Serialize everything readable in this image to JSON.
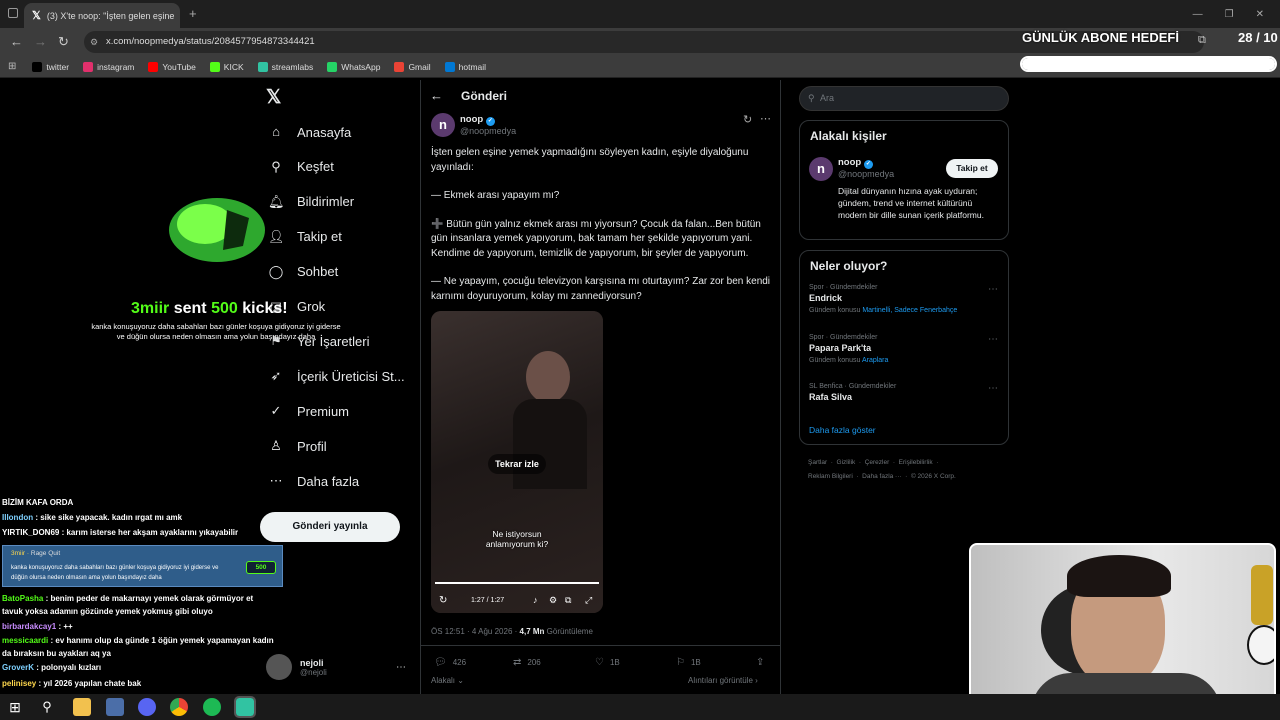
{
  "browser": {
    "tab_title": "(3) X'te noop: \"İşten gelen eşine",
    "url": "x.com/noopmedya/status/2084577954873344421",
    "bookmarks": [
      {
        "label": "twitter",
        "color": "#000000"
      },
      {
        "label": "instagram",
        "color": "#e1306c"
      },
      {
        "label": "YouTube",
        "color": "#ff0000"
      },
      {
        "label": "KICK",
        "color": "#53fc18"
      },
      {
        "label": "streamlabs",
        "color": "#31c3a2"
      },
      {
        "label": "WhatsApp",
        "color": "#25d366"
      },
      {
        "label": "Gmail",
        "color": "#ea4335"
      },
      {
        "label": "hotmail",
        "color": "#0078d4"
      }
    ]
  },
  "goal": {
    "title": "GÜNLÜK ABONE HEDEFİ",
    "count": "28 / 10",
    "fraction": 1.0
  },
  "alert": {
    "name": "3miir",
    "sent": "sent",
    "amount": "500",
    "kicks": "kicks!",
    "message": "kanka konuşuyoruz daha sabahları bazı günler koşuya gidiyoruz iyi giderse ve düğün olursa neden olmasın ama yolun başındayız daha"
  },
  "nav": {
    "items": [
      {
        "label": "Anasayfa",
        "icon": "home-icon",
        "glyph": "⌂"
      },
      {
        "label": "Keşfet",
        "icon": "search-icon",
        "glyph": "⚲"
      },
      {
        "label": "Bildirimler",
        "icon": "bell-icon",
        "glyph": "🔔︎"
      },
      {
        "label": "Takip et",
        "icon": "follow-icon",
        "glyph": "👤︎"
      },
      {
        "label": "Sohbet",
        "icon": "chat-icon",
        "glyph": "◯"
      },
      {
        "label": "Grok",
        "icon": "grok-icon",
        "glyph": "◪"
      },
      {
        "label": "Yer İşaretleri",
        "icon": "bookmark-icon",
        "glyph": "⚑"
      },
      {
        "label": "İçerik Üreticisi St...",
        "icon": "rocket-icon",
        "glyph": "➶"
      },
      {
        "label": "Premium",
        "icon": "premium-icon",
        "glyph": "✓"
      },
      {
        "label": "Profil",
        "icon": "profile-icon",
        "glyph": "♙"
      },
      {
        "label": "Daha fazla",
        "icon": "more-icon",
        "glyph": "⋯"
      }
    ],
    "post_button": "Gönderi yayınla",
    "account": {
      "name": "nejoli",
      "handle": "@nejoli"
    }
  },
  "main": {
    "header": "Gönderi",
    "author": {
      "name": "noop",
      "handle": "@noopmedya"
    },
    "text": [
      "İşten gelen eşine yemek yapmadığını söyleyen kadın, eşiyle diyaloğunu yayınladı:",
      "— Ekmek arası yapayım mı?",
      "➕ Bütün gün yalnız ekmek arası mı yiyorsun? Çocuk da falan...Ben bütün gün insanlara yemek yapıyorum, bak tamam her şekilde yapıyorum yani. Kendime de yapıyorum, temizlik de yapıyorum, bir şeyler de yapıyorum.",
      "— Ne yapayım, çocuğu televizyon karşısına mı oturtayım? Zar zor ben kendi karnımı doyuruyorum, kolay mı zannediyorsun?"
    ],
    "video": {
      "replay": "Tekrar izle",
      "subtitle": "Ne istiyorsun anlamıyorum ki?",
      "time": "1:27 / 1:27",
      "progress": 1.0
    },
    "meta": {
      "time": "ÖS 12:51 · 4 Ağu 2026 · ",
      "views": "4,7 Mn",
      "views_label": " Görüntüleme"
    },
    "metrics": {
      "replies": "426",
      "reposts": "206",
      "likes": "1B",
      "bookmarks": "1B"
    },
    "relevant_label": "Alakalı",
    "quotes_label": "Alıntıları görüntüle"
  },
  "right": {
    "search_placeholder": "Ara",
    "people_title": "Alakalı kişiler",
    "person": {
      "name": "noop",
      "handle": "@noopmedya",
      "follow": "Takip et",
      "bio": "Dijital dünyanın hızına ayak uyduran; gündem, trend ve internet kültürünü modern bir dille sunan içerik platformu."
    },
    "trends_title": "Neler oluyor?",
    "trends": [
      {
        "meta": "Spor · Gündemdekiler",
        "name": "Endrick",
        "sub_prefix": "Gündem konusu ",
        "sub_link": "Martinelli, Sadece Fenerbahçe"
      },
      {
        "meta": "Spor · Gündemdekiler",
        "name": "Papara Park'ta",
        "sub_prefix": "Gündem konusu ",
        "sub_link": "Araplara"
      },
      {
        "meta": "SL Benfica · Gündemdekiler",
        "name": "Rafa Silva",
        "sub_prefix": "",
        "sub_link": ""
      }
    ],
    "show_more": "Daha fazla göster",
    "footer1": "Şartlar  ·  Gizlilik  ·  Çerezler  ·  Erişilebilirlik  ·",
    "footer2": "Reklam Bilgileri  ·  Daha fazla ···  ·  © 2026 X Corp."
  },
  "chat": [
    {
      "user": "",
      "msg": "BİZİM KAFA ORDA",
      "color": "#ffffff"
    },
    {
      "user": "Illondon",
      "msg": " : sike sike yapacak. kadın ırgat mı amk",
      "color": "#7fd1ff"
    },
    {
      "user": "YIRTIK_DON69",
      "msg": " : karım isterse her akşam ayaklarını yıkayabilir",
      "color": "#ffffff"
    },
    {
      "user": "BatoPasha",
      "msg": " : benim peder de makarnayı yemek olarak görmüyor et",
      "color": "#53fc18"
    },
    {
      "user": "",
      "msg": "tavuk yoksa adamın gözünde yemek yokmuş gibi oluyo",
      "color": "#ffffff"
    },
    {
      "user": "birbardakcay1",
      "msg": " : ++",
      "color": "#c98cff"
    },
    {
      "user": "messicaardi",
      "msg": " : ev hanımı olup da günde 1 öğün yemek yapamayan kadın",
      "color": "#53fc18"
    },
    {
      "user": "",
      "msg": "da bıraksın bu ayakları aq ya",
      "color": "#ffffff"
    },
    {
      "user": "GroverK",
      "msg": " : polonyalı kızları",
      "color": "#7fd1ff"
    },
    {
      "user": "pelinisey",
      "msg": " : yıl 2026 yapılan chate bak",
      "color": "#ffd84d"
    },
    {
      "user": "sonukotobusyami",
      "msg": " : eşler arasında",
      "color": "#ff6b6b"
    }
  ],
  "chat_card": {
    "user": "3miir",
    "tag": "Rage Quit",
    "amount": "500",
    "message": "kanka konuşuyoruz daha sabahları bazı günler koşuya gidiyoruz iyi giderse ve düğün olursa neden olmasın ama yolun başındayız daha"
  }
}
